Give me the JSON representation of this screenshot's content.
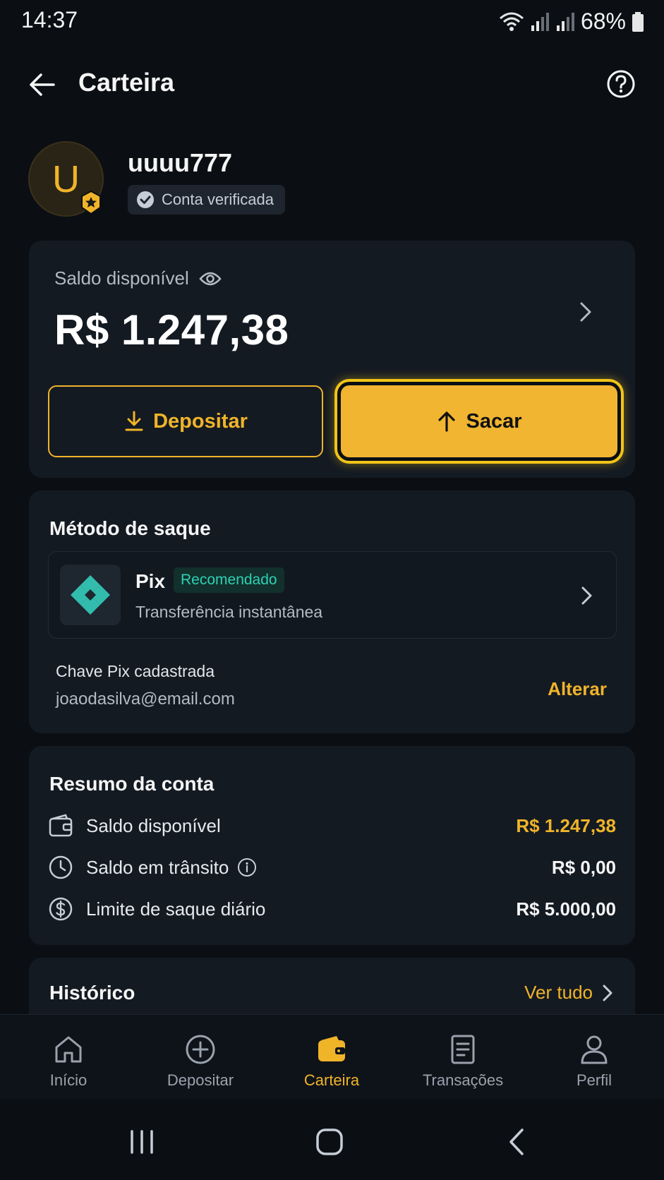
{
  "status_bar": {
    "time": "14:37",
    "battery": "68%"
  },
  "header": {
    "title": "Carteira"
  },
  "profile": {
    "avatar_letter": "U",
    "username": "uuuu777",
    "verified_label": "Conta verificada"
  },
  "balance": {
    "label": "Saldo disponível",
    "amount": "R$ 1.247,38",
    "deposit_label": "Depositar",
    "withdraw_label": "Sacar"
  },
  "method": {
    "title": "Método de saque",
    "pix_name": "Pix",
    "pix_tag": "Recomendado",
    "pix_desc": "Transferência instantânea",
    "key_label": "Chave Pix cadastrada",
    "key_value": "joaodasilva@email.com",
    "alter_label": "Alterar"
  },
  "summary": {
    "title": "Resumo da conta",
    "rows": [
      {
        "label": "Saldo disponível",
        "value": "R$ 1.247,38",
        "icon": "wallet-icon"
      },
      {
        "label": "Saldo em trânsito",
        "value": "R$ 0,00",
        "icon": "clock-icon"
      },
      {
        "label": "Limite de saque diário",
        "value": "R$ 5.000,00",
        "icon": "dollar-icon"
      }
    ]
  },
  "history": {
    "title": "Histórico",
    "see_all": "Ver tudo"
  },
  "bottom_nav": {
    "items": [
      {
        "label": "Início",
        "icon": "home-icon"
      },
      {
        "label": "Depositar",
        "icon": "plus-circle-icon"
      },
      {
        "label": "Carteira",
        "icon": "wallet-icon"
      },
      {
        "label": "Transações",
        "icon": "document-icon"
      },
      {
        "label": "Perfil",
        "icon": "user-icon"
      }
    ],
    "active": "Carteira"
  },
  "colors": {
    "accent": "#f0b429",
    "background": "#0b0f14",
    "card": "#141a22",
    "pix": "#32bcad"
  }
}
